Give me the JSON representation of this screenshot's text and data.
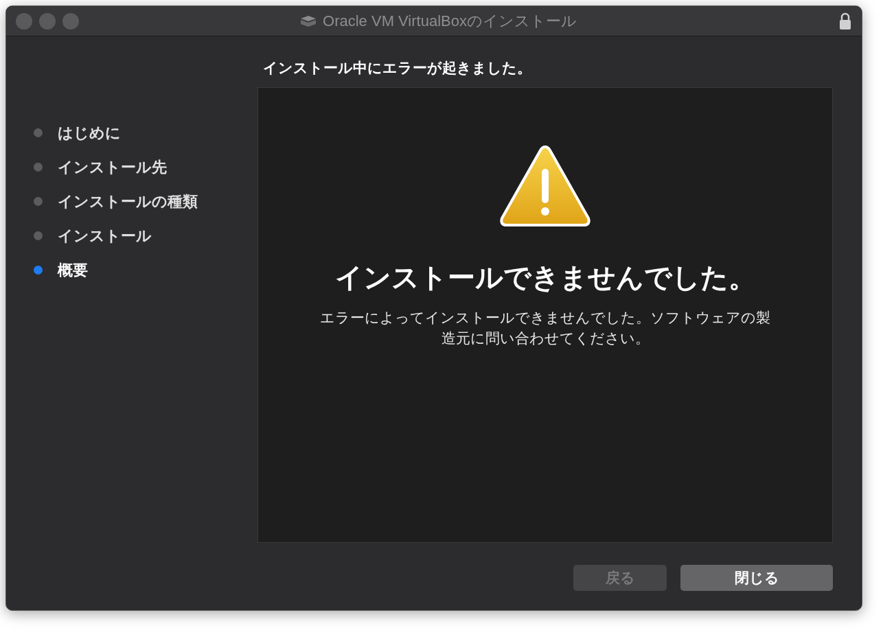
{
  "window": {
    "title": "Oracle VM VirtualBoxのインストール",
    "locked": true
  },
  "steps": [
    {
      "label": "はじめに",
      "selected": false
    },
    {
      "label": "インストール先",
      "selected": false
    },
    {
      "label": "インストールの種類",
      "selected": false
    },
    {
      "label": "インストール",
      "selected": false
    },
    {
      "label": "概要",
      "selected": true
    }
  ],
  "heading": "インストール中にエラーが起きました。",
  "panel": {
    "title": "インストールできませんでした。",
    "message": "エラーによってインストールできませんでした。ソフトウェアの製造元に問い合わせてください。"
  },
  "buttons": [
    {
      "label": "戻る",
      "disabled": true
    },
    {
      "label": "閉じる",
      "disabled": false
    }
  ]
}
